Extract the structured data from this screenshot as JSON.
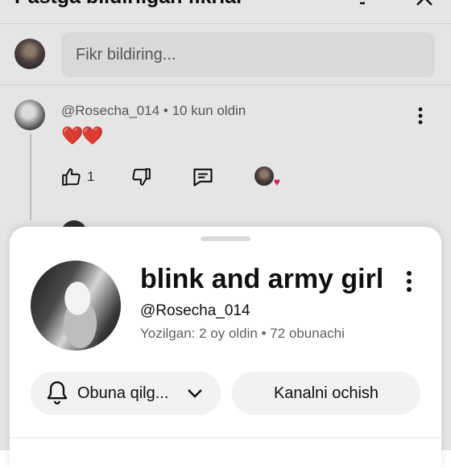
{
  "header": {
    "title": "Pastga bildirilgan fikrlar"
  },
  "composer": {
    "placeholder": "Fikr bildiring..."
  },
  "comment": {
    "meta": "@Rosecha_014 • 10 kun oldin",
    "text": "❤️❤️",
    "likes": "1"
  },
  "sheet": {
    "channel_name": "blink and army girl",
    "handle": "@Rosecha_014",
    "stats": "Yozilgan: 2 oy oldin • 72 obunachi",
    "subscribe_label": "Obuna qilg...",
    "open_channel_label": "Kanalni ochish"
  },
  "colors": {
    "heart": "#e0245e",
    "pill_bg": "#f2f2f2",
    "text_secondary": "#606060"
  }
}
